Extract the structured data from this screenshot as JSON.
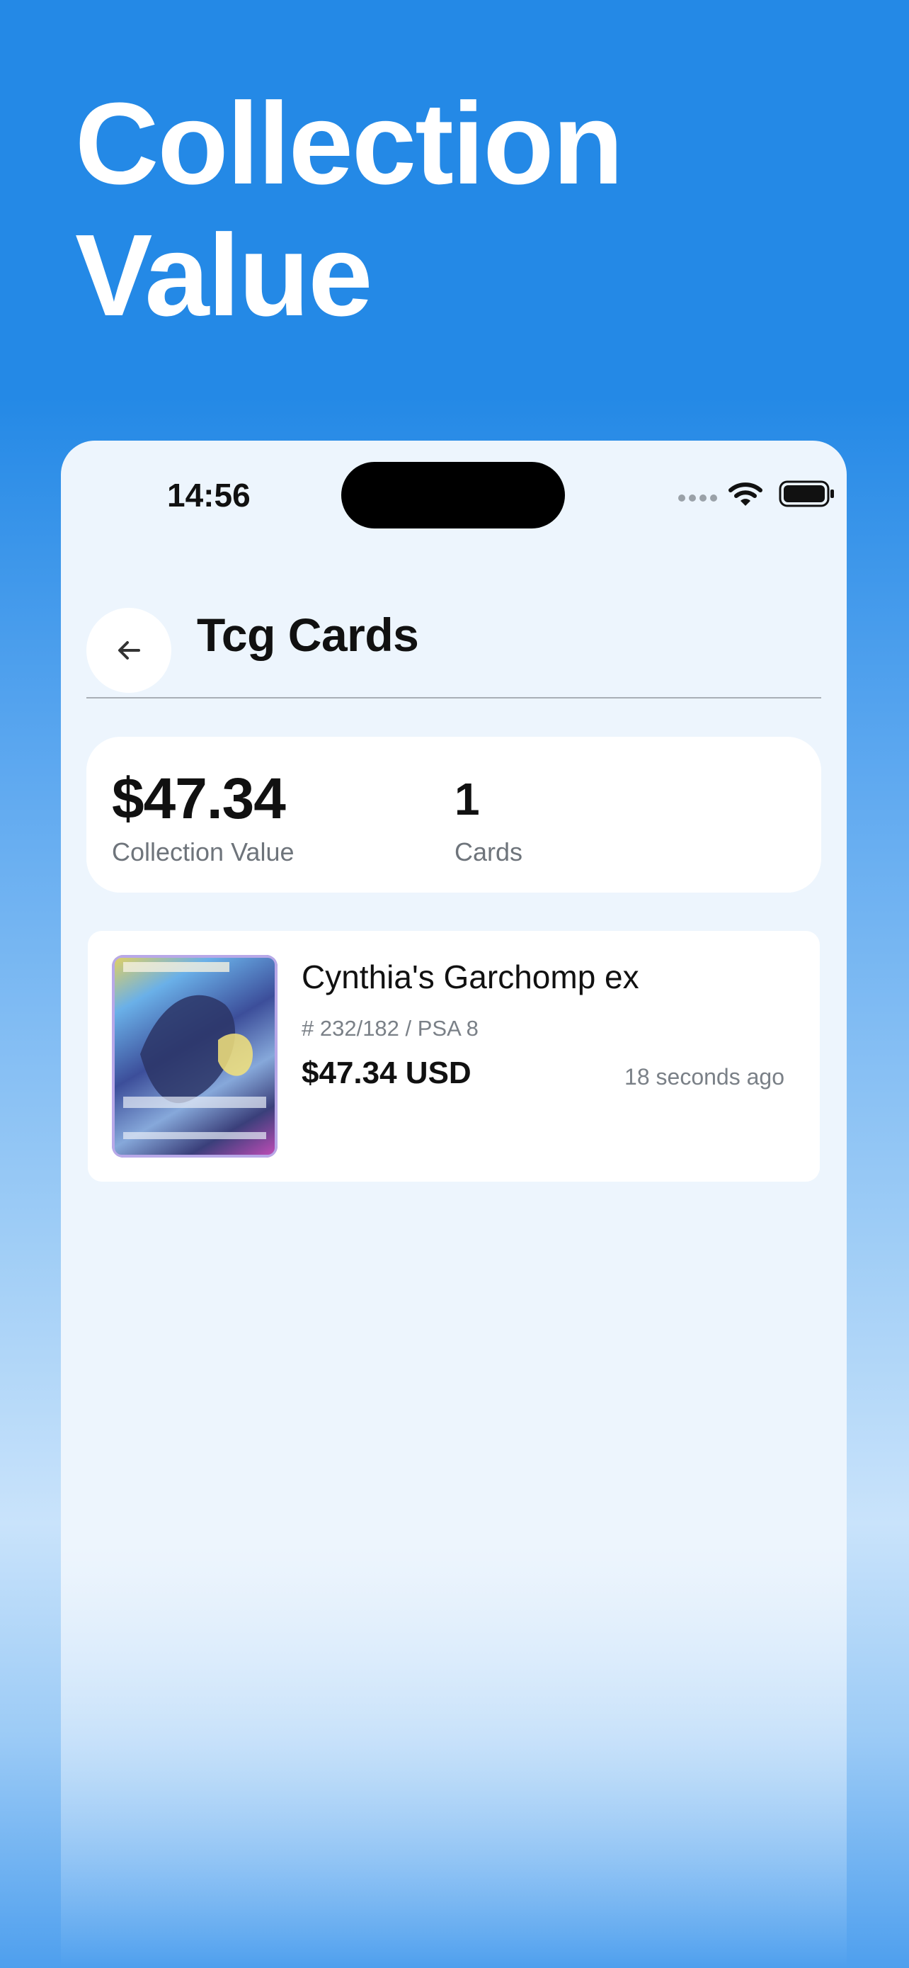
{
  "hero": {
    "line1": "Collection",
    "line2": "Value"
  },
  "status_bar": {
    "time": "14:56"
  },
  "header": {
    "title": "Tcg Cards"
  },
  "summary": {
    "value": "$47.34",
    "value_label": "Collection Value",
    "count": "1",
    "count_label": "Cards"
  },
  "items": [
    {
      "name": "Cynthia's Garchomp ex",
      "meta": "# 232/182 / PSA 8",
      "price": "$47.34 USD",
      "updated": "18 seconds ago"
    }
  ],
  "colors": {
    "brand_blue": "#2489E6",
    "panel_bg": "#EDF5FD",
    "card_bg": "#FFFFFF"
  },
  "icons": [
    "back-arrow-icon",
    "wifi-icon",
    "battery-icon",
    "cellular-signal-icon"
  ]
}
